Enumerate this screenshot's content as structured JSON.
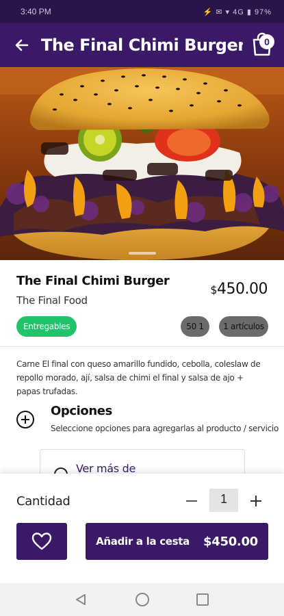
{
  "status_bar": {
    "time": "3:40 PM",
    "icons": "⚡ ✉ ▾ 4G ▮ 97%"
  },
  "header": {
    "title": "The Final Chimi Burger",
    "cart_count": "0"
  },
  "product": {
    "name": "The Final Chimi Burger",
    "store": "The Final Food",
    "price_currency": "$",
    "price_amount": "450.00",
    "badge": "Entregables",
    "chip_code": "50 1",
    "chip_items": "1 artículos",
    "description": "Carne El final con queso amarillo fundido, cebolla, coleslaw de repollo morado, ají, salsa de chimi el final y salsa de ajo + papas trufadas."
  },
  "options": {
    "title": "Opciones",
    "subtitle": "Seleccione opciones para agregarlas al producto / servicio",
    "more_label": "Ver más de"
  },
  "footer": {
    "quantity_label": "Cantidad",
    "quantity_value": "1",
    "add_label": "Añadir a la cesta",
    "add_price": "$450.00"
  },
  "colors": {
    "primary": "#3a1a66",
    "status_bar": "#2b1449",
    "badge_green": "#1fc46a",
    "chip_gray": "#6b6b6b"
  },
  "icons": [
    "back-arrow-icon",
    "cart-icon",
    "plus-circle-icon",
    "heart-icon",
    "minus-icon",
    "plus-icon",
    "nav-back-icon",
    "nav-home-icon",
    "nav-recents-icon"
  ]
}
